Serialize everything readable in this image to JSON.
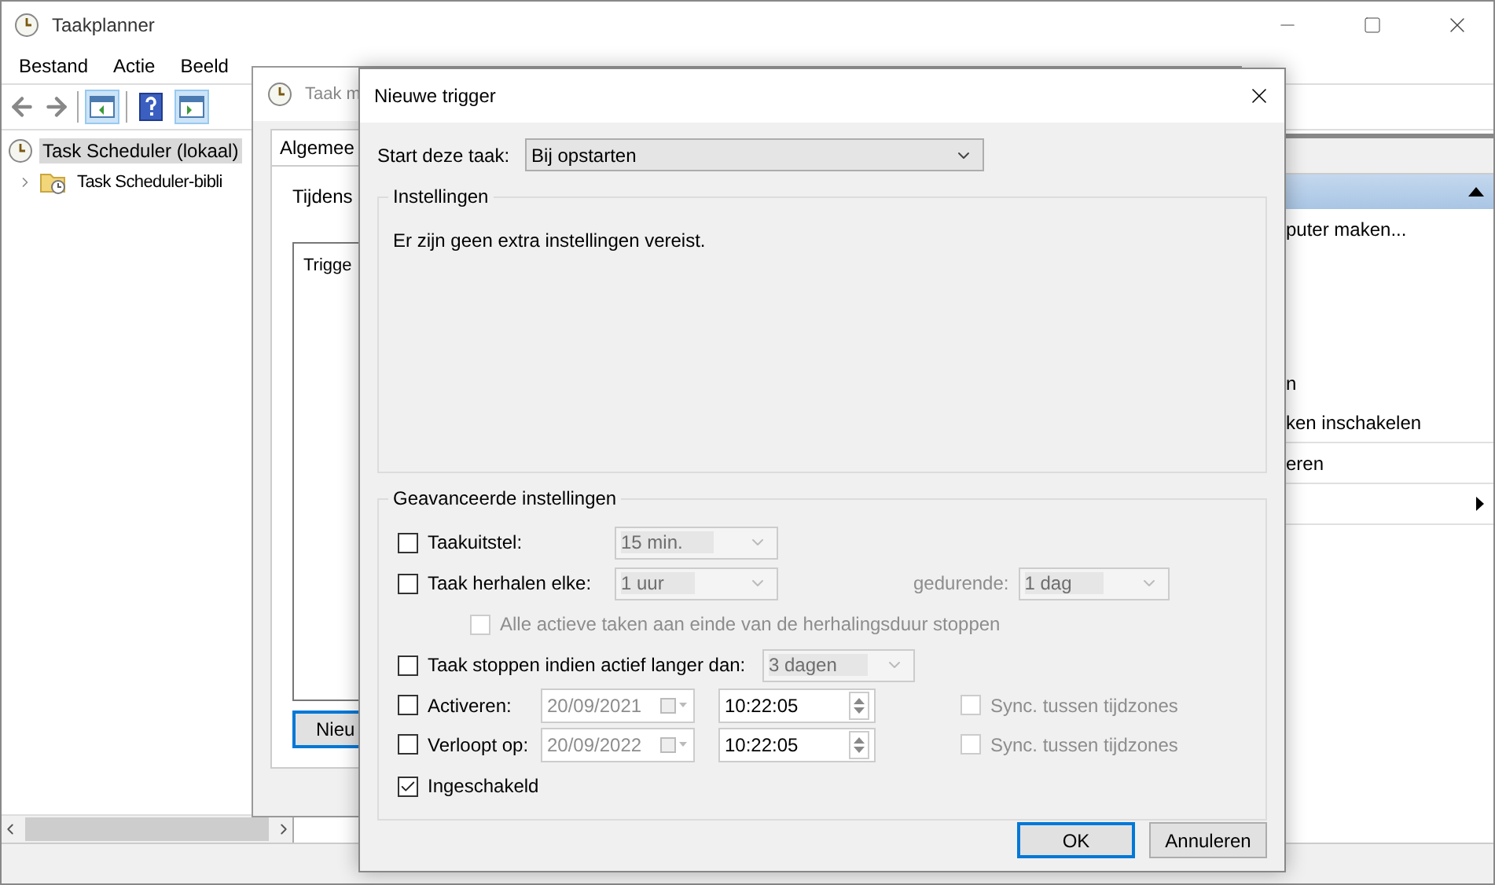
{
  "main_window": {
    "title": "Taakplanner",
    "menu": [
      "Bestand",
      "Actie",
      "Beeld"
    ],
    "tree": [
      {
        "label": "Task Scheduler (lokaal)",
        "selected": true,
        "children": [
          {
            "label": "Task Scheduler-bibli",
            "selected": false,
            "expanded": false
          }
        ]
      }
    ],
    "actions": [
      {
        "kind": "text",
        "label": "puter maken..."
      },
      {
        "kind": "text",
        "label": "n"
      },
      {
        "kind": "text",
        "label": "ken inschakelen"
      },
      {
        "kind": "text",
        "label": "eren"
      },
      {
        "kind": "submenu"
      }
    ]
  },
  "task_dialog": {
    "title": "Taak m",
    "tab": "Algemee",
    "section_label": "Tijdens",
    "list_header": "Trigge",
    "new_button": "Nieu"
  },
  "trigger_dialog": {
    "title": "Nieuwe trigger",
    "start_task": {
      "label": "Start deze taak:",
      "value": "Bij opstarten"
    },
    "settings": {
      "title": "Instellingen",
      "message": "Er zijn geen extra instellingen vereist."
    },
    "advanced": {
      "title": "Geavanceerde instellingen",
      "delay": {
        "label": "Taakuitstel:",
        "checked": false,
        "value": "15 min."
      },
      "repeat": {
        "label": "Taak herhalen elke:",
        "checked": false,
        "value": "1 uur",
        "duration_label": "gedurende:",
        "duration_value": "1 dag"
      },
      "stop_all": {
        "label": "Alle actieve taken aan einde van de herhalingsduur stoppen",
        "checked": false
      },
      "stop_if": {
        "label": "Taak stoppen indien actief langer dan:",
        "checked": false,
        "value": "3 dagen"
      },
      "activate": {
        "label": "Activeren:",
        "checked": false,
        "date": "20/09/2021",
        "time": "10:22:05",
        "sync_label": "Sync. tussen tijdzones",
        "sync_checked": false
      },
      "expire": {
        "label": "Verloopt op:",
        "checked": false,
        "date": "20/09/2022",
        "time": "10:22:05",
        "sync_label": "Sync. tussen tijdzones",
        "sync_checked": false
      },
      "enabled": {
        "label": "Ingeschakeld",
        "checked": true
      }
    },
    "buttons": [
      {
        "label": "OK",
        "default": true
      },
      {
        "label": "Annuleren",
        "default": false
      }
    ]
  }
}
